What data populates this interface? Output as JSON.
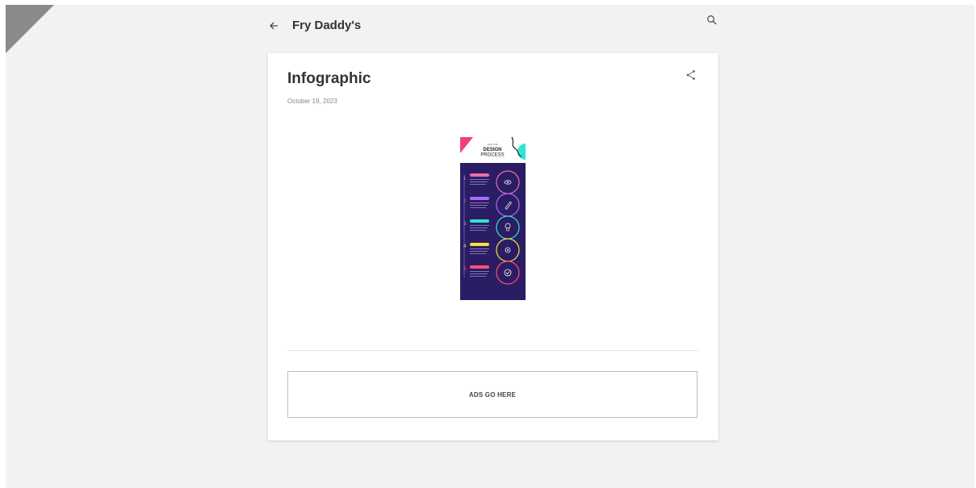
{
  "header": {
    "blog_title": "Fry Daddy's",
    "back_icon": "arrow-left-icon",
    "search_icon": "search-icon"
  },
  "post": {
    "title": "Infographic",
    "date": "October 19, 2023",
    "share_icon": "share-icon"
  },
  "infographic": {
    "heading_small": "THE FIVE",
    "heading_line1": "DESIGN",
    "heading_line2": "PROCESS",
    "steps": [
      {
        "number": "1",
        "color": "#f06bb0",
        "icon": "eye-icon"
      },
      {
        "number": "2",
        "color": "#a86bff",
        "icon": "pencil-icon"
      },
      {
        "number": "3",
        "color": "#2ee6d0",
        "icon": "lightbulb-icon"
      },
      {
        "number": "4",
        "color": "#f2e23a",
        "icon": "gear-icon"
      },
      {
        "number": "5",
        "color": "#ff4f7a",
        "icon": "check-icon"
      }
    ]
  },
  "ad": {
    "label": "ADS GO HERE"
  },
  "colors": {
    "background": "#f2f2f2",
    "card": "#ffffff",
    "infographic_bg": "#2b1d63"
  }
}
